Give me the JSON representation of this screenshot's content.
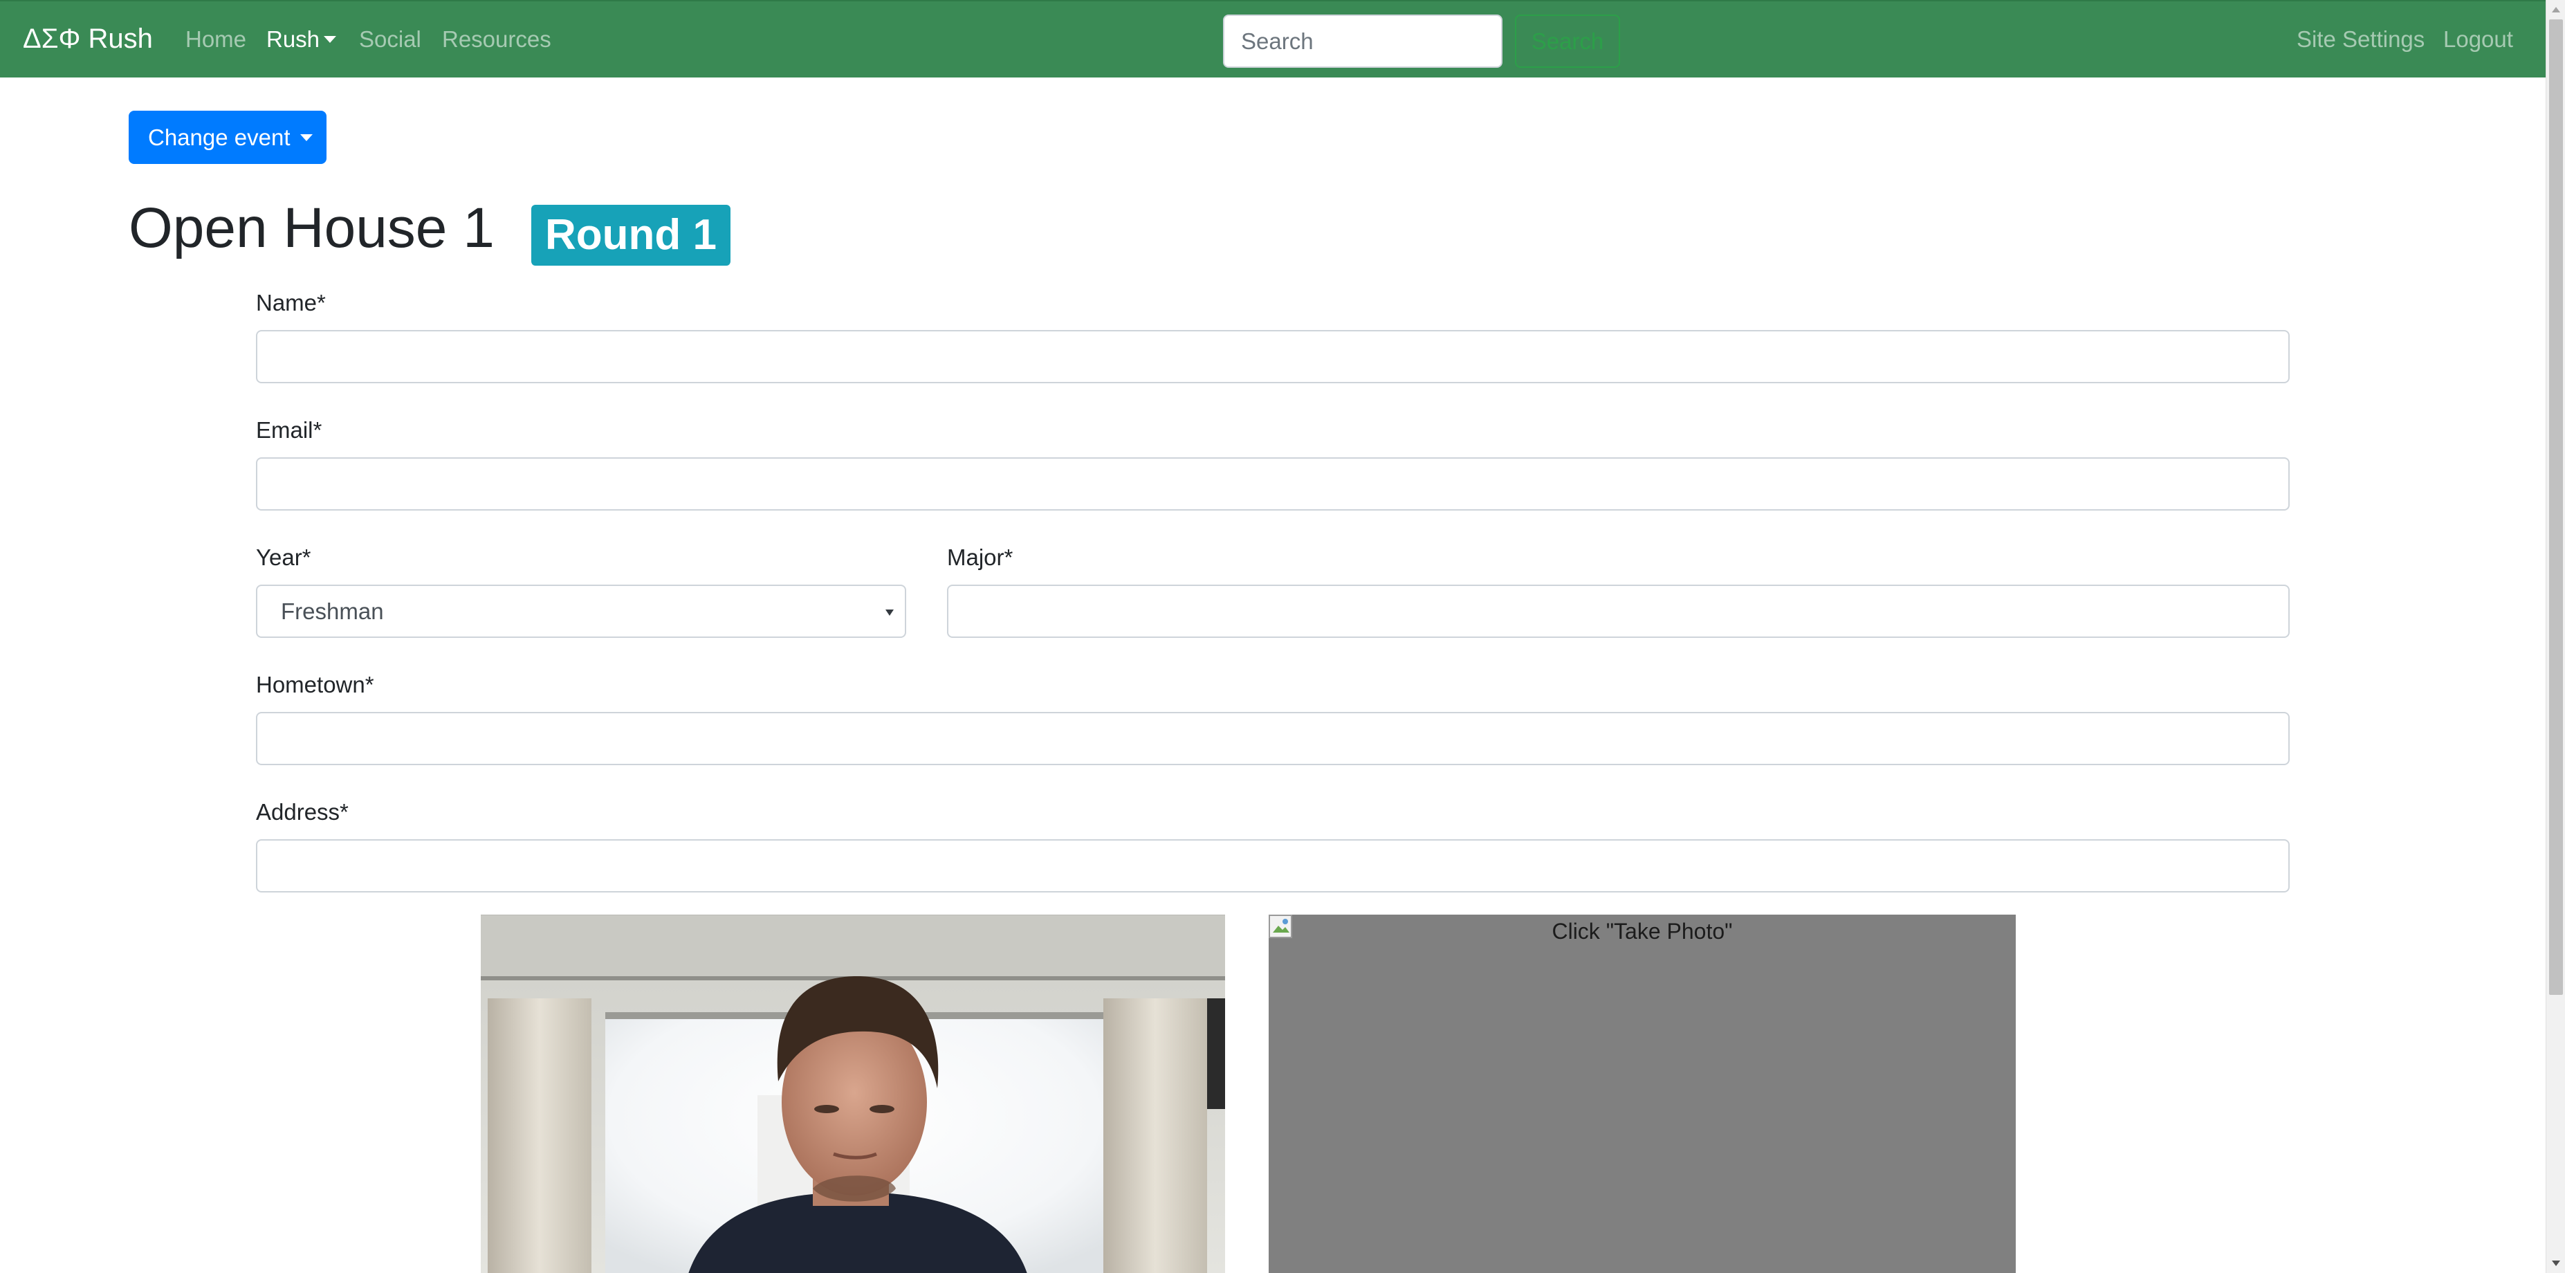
{
  "navbar": {
    "brand": "ΔΣΦ Rush",
    "links": [
      {
        "label": "Home"
      },
      {
        "label": "Rush"
      },
      {
        "label": "Social"
      },
      {
        "label": "Resources"
      }
    ],
    "search": {
      "placeholder": "Search",
      "value": "",
      "button_label": "Search"
    },
    "right_links": [
      {
        "label": "Site Settings"
      },
      {
        "label": "Logout"
      }
    ],
    "background_color": "#3a8a55"
  },
  "event": {
    "change_button_label": "Change event",
    "title": "Open House 1",
    "round_badge": "Round 1"
  },
  "form": {
    "name_label": "Name*",
    "name_value": "",
    "email_label": "Email*",
    "email_value": "",
    "year_label": "Year*",
    "year_value": "Freshman",
    "major_label": "Major*",
    "major_value": "",
    "hometown_label": "Hometown*",
    "hometown_value": "",
    "address_label": "Address*",
    "address_value": ""
  },
  "photo": {
    "alt_text": "Click \"Take Photo\""
  },
  "colors": {
    "primary": "#007bff",
    "info": "#17a2b8",
    "success": "#28a745"
  }
}
